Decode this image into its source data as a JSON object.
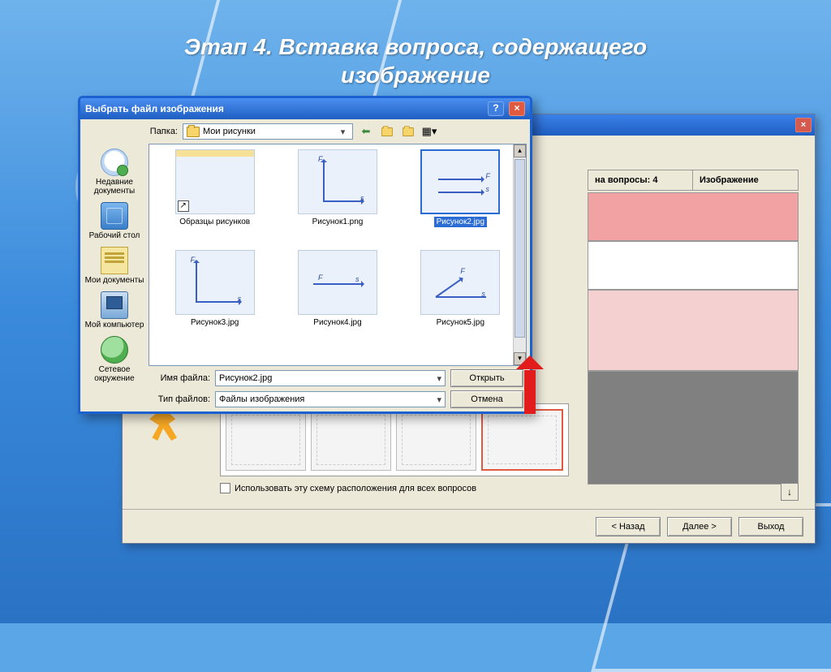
{
  "title": {
    "line1": "Этап 4. Вставка вопроса, содержащего",
    "line2": "изображение"
  },
  "wizard": {
    "header_time_label": "на вопросы: 4",
    "header_image_label": "Изображение",
    "use_layout_checkbox_label": "Использовать эту схему расположения для всех вопросов",
    "footer": {
      "back": "< Назад",
      "next": "Далее >",
      "exit": "Выход"
    }
  },
  "dialog": {
    "title": "Выбрать файл изображения",
    "folder_label": "Папка:",
    "folder_value": "Мои рисунки",
    "toolbar_icons": {
      "back": "back-icon",
      "up": "up-one-level-icon",
      "new_folder": "new-folder-icon",
      "view": "view-menu-icon"
    },
    "places": [
      {
        "label": "Недавние документы"
      },
      {
        "label": "Рабочий стол"
      },
      {
        "label": "Мои документы"
      },
      {
        "label": "Мой компьютер"
      },
      {
        "label": "Сетевое окружение"
      }
    ],
    "files": [
      {
        "label": "Образцы рисунков",
        "type": "samples",
        "selected": false
      },
      {
        "label": "Рисунок1.png",
        "type": "phys1",
        "selected": false
      },
      {
        "label": "Рисунок2.jpg",
        "type": "phys2",
        "selected": true
      },
      {
        "label": "Рисунок3.jpg",
        "type": "phys3",
        "selected": false
      },
      {
        "label": "Рисунок4.jpg",
        "type": "phys4",
        "selected": false
      },
      {
        "label": "Рисунок5.jpg",
        "type": "phys5",
        "selected": false
      }
    ],
    "filename_label": "Имя файла:",
    "filename_value": "Рисунок2.jpg",
    "filetype_label": "Тип файлов:",
    "filetype_value": "Файлы изображения",
    "open_button": "Открыть",
    "cancel_button": "Отмена"
  }
}
